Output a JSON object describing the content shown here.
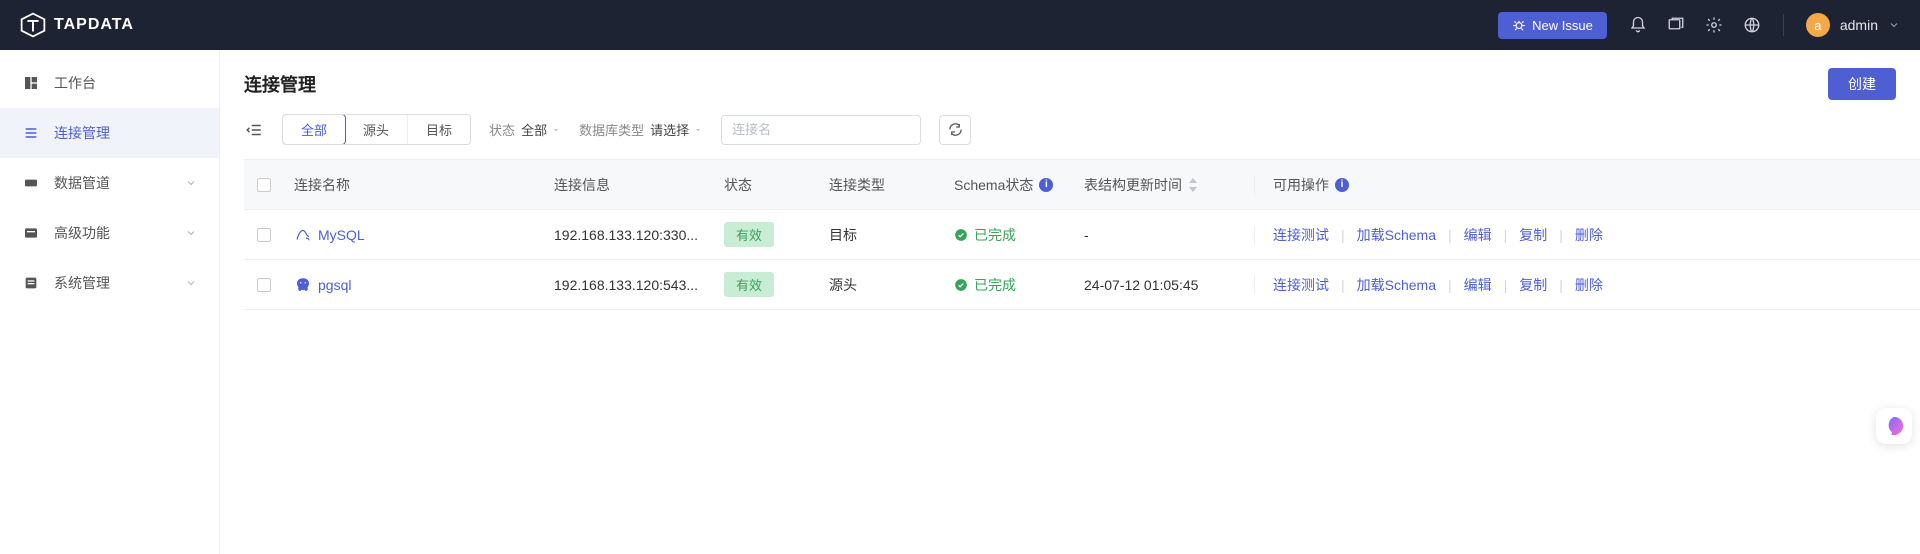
{
  "header": {
    "brand": "TAPDATA",
    "new_issue_label": "New Issue",
    "user": {
      "avatar_letter": "a",
      "name": "admin"
    }
  },
  "sidebar": {
    "items": [
      {
        "label": "工作台"
      },
      {
        "label": "连接管理"
      },
      {
        "label": "数据管道"
      },
      {
        "label": "高级功能"
      },
      {
        "label": "系统管理"
      }
    ]
  },
  "page": {
    "title": "连接管理",
    "create_label": "创建"
  },
  "filters": {
    "tabs": {
      "all": "全部",
      "source": "源头",
      "target": "目标"
    },
    "status_label": "状态",
    "status_value": "全部",
    "dbtype_label": "数据库类型",
    "dbtype_value": "请选择",
    "search_placeholder": "连接名"
  },
  "table": {
    "columns": {
      "name": "连接名称",
      "info": "连接信息",
      "status": "状态",
      "type": "连接类型",
      "schema": "Schema状态",
      "updated": "表结构更新时间",
      "actions": "可用操作"
    },
    "status_badge": "有效",
    "schema_done": "已完成",
    "rows": [
      {
        "name": "MySQL",
        "info": "192.168.133.120:330...",
        "type": "目标",
        "updated": "-",
        "icon": "mysql"
      },
      {
        "name": "pgsql",
        "info": "192.168.133.120:543...",
        "type": "源头",
        "updated": "24-07-12 01:05:45",
        "icon": "postgres"
      }
    ],
    "actions": {
      "test": "连接测试",
      "load": "加载Schema",
      "edit": "编辑",
      "copy": "复制",
      "delete": "删除"
    }
  }
}
